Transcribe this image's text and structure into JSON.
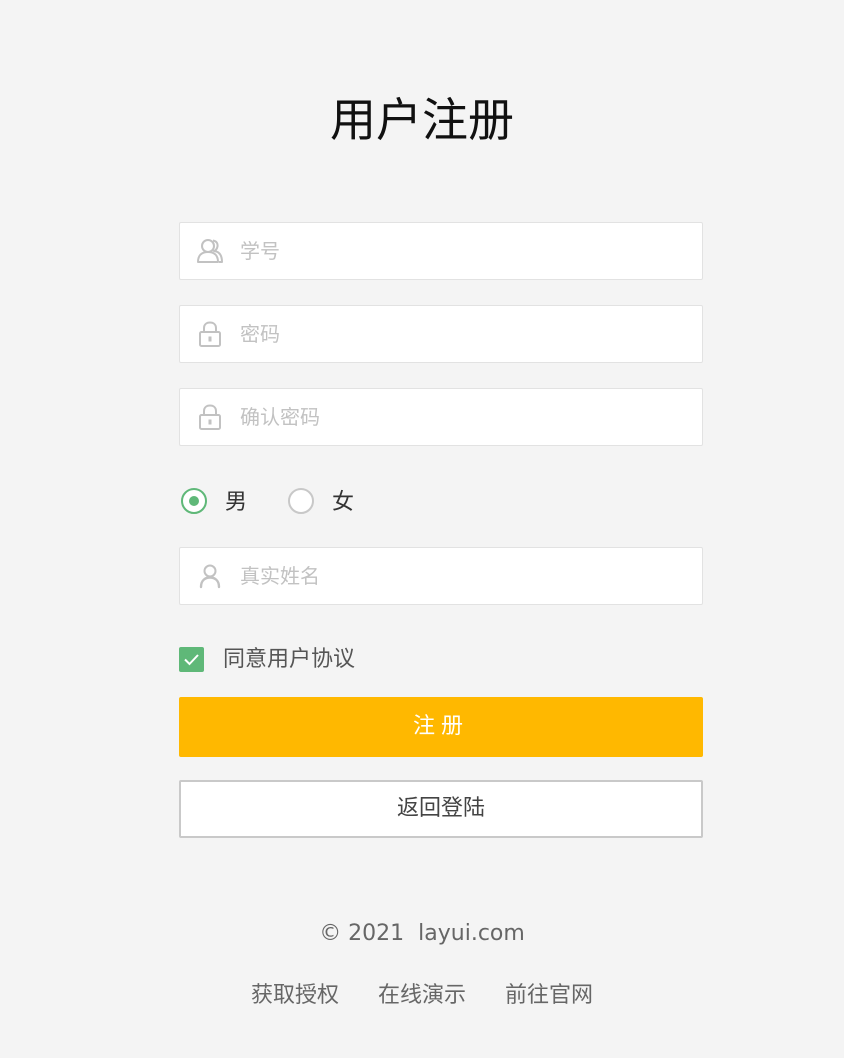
{
  "page": {
    "title": "用户注册"
  },
  "form": {
    "student_id": {
      "placeholder": "学号",
      "value": "",
      "icon": "user-outline-icon"
    },
    "password": {
      "placeholder": "密码",
      "value": "",
      "icon": "lock-icon"
    },
    "confirm_password": {
      "placeholder": "确认密码",
      "value": "",
      "icon": "lock-icon"
    },
    "gender": {
      "options": [
        {
          "label": "男",
          "checked": true
        },
        {
          "label": "女",
          "checked": false
        }
      ]
    },
    "real_name": {
      "placeholder": "真实姓名",
      "value": "",
      "icon": "person-icon"
    },
    "agree": {
      "label": "同意用户协议",
      "checked": true
    },
    "register_button": "注册",
    "back_button": "返回登陆"
  },
  "footer": {
    "copyright": "© 2021  layui.com",
    "links": [
      "获取授权",
      "在线演示",
      "前往官网"
    ]
  },
  "colors": {
    "background": "#f4f4f4",
    "primary": "#ffb800",
    "accent_green": "#5fb878",
    "placeholder": "#c2c2c2",
    "border": "#e2e2e2"
  }
}
